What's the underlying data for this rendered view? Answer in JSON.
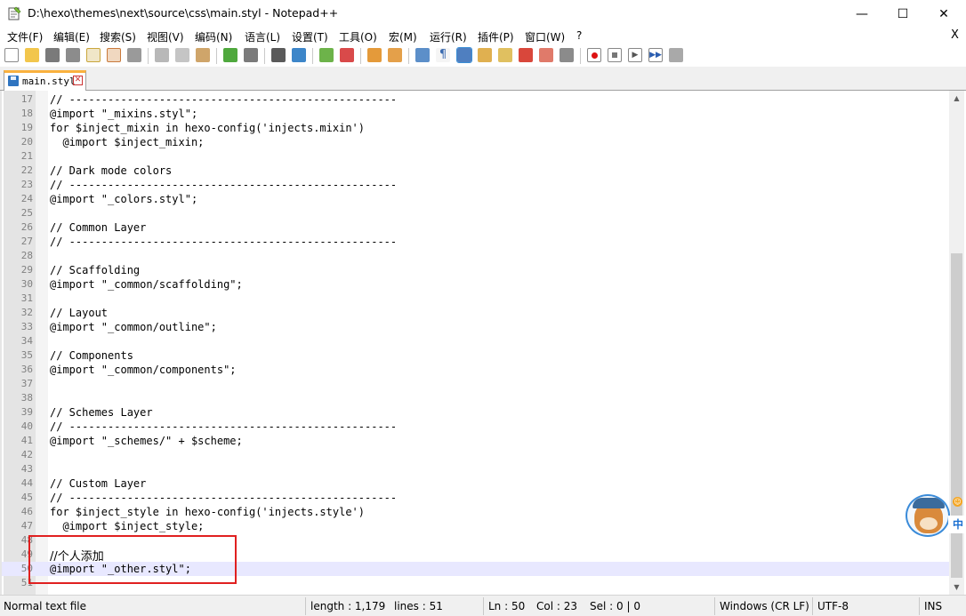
{
  "window": {
    "title": "D:\\hexo\\themes\\next\\source\\css\\main.styl - Notepad++",
    "min_glyph": "—",
    "max_glyph": "☐",
    "close_glyph": "✕"
  },
  "menu": {
    "items": [
      "文件(F)",
      "编辑(E)",
      "搜索(S)",
      "视图(V)",
      "编码(N)",
      "语言(L)",
      "设置(T)",
      "工具(O)",
      "宏(M)",
      "运行(R)",
      "插件(P)",
      "窗口(W)",
      "?"
    ],
    "close_glyph": "X"
  },
  "toolbar": {
    "icons": [
      "new-file-icon",
      "open-file-icon",
      "save-icon",
      "save-all-icon",
      "close-icon",
      "close-all-icon",
      "print-icon",
      "cut-icon",
      "copy-icon",
      "paste-icon",
      "undo-icon",
      "redo-icon",
      "find-icon",
      "replace-icon",
      "zoom-in-icon",
      "zoom-out-icon",
      "sync-vertical-icon",
      "sync-horizontal-icon",
      "word-wrap-icon",
      "show-all-characters-icon",
      "indent-guide-icon",
      "user-language-icon",
      "document-map-icon",
      "function-list-icon",
      "folder-as-workspace-icon",
      "monitoring-icon",
      "record-macro-icon",
      "stop-recording-icon",
      "playback-macro-icon",
      "run-macro-multiple-icon",
      "save-macro-icon"
    ]
  },
  "tab": {
    "label": "main.styl",
    "close_glyph": "✕"
  },
  "editor": {
    "current_line": 50,
    "lines": [
      {
        "n": "17",
        "text": "// ---------------------------------------------------"
      },
      {
        "n": "18",
        "text": "@import \"_mixins.styl\";"
      },
      {
        "n": "19",
        "text": "for $inject_mixin in hexo-config('injects.mixin')"
      },
      {
        "n": "20",
        "text": "  @import $inject_mixin;"
      },
      {
        "n": "21",
        "text": ""
      },
      {
        "n": "22",
        "text": "// Dark mode colors"
      },
      {
        "n": "23",
        "text": "// ---------------------------------------------------"
      },
      {
        "n": "24",
        "text": "@import \"_colors.styl\";"
      },
      {
        "n": "25",
        "text": ""
      },
      {
        "n": "26",
        "text": "// Common Layer"
      },
      {
        "n": "27",
        "text": "// ---------------------------------------------------"
      },
      {
        "n": "28",
        "text": ""
      },
      {
        "n": "29",
        "text": "// Scaffolding"
      },
      {
        "n": "30",
        "text": "@import \"_common/scaffolding\";"
      },
      {
        "n": "31",
        "text": ""
      },
      {
        "n": "32",
        "text": "// Layout"
      },
      {
        "n": "33",
        "text": "@import \"_common/outline\";"
      },
      {
        "n": "34",
        "text": ""
      },
      {
        "n": "35",
        "text": "// Components"
      },
      {
        "n": "36",
        "text": "@import \"_common/components\";"
      },
      {
        "n": "37",
        "text": ""
      },
      {
        "n": "38",
        "text": ""
      },
      {
        "n": "39",
        "text": "// Schemes Layer"
      },
      {
        "n": "40",
        "text": "// ---------------------------------------------------"
      },
      {
        "n": "41",
        "text": "@import \"_schemes/\" + $scheme;"
      },
      {
        "n": "42",
        "text": ""
      },
      {
        "n": "43",
        "text": ""
      },
      {
        "n": "44",
        "text": "// Custom Layer"
      },
      {
        "n": "45",
        "text": "// ---------------------------------------------------"
      },
      {
        "n": "46",
        "text": "for $inject_style in hexo-config('injects.style')"
      },
      {
        "n": "47",
        "text": "  @import $inject_style;"
      },
      {
        "n": "48",
        "text": ""
      },
      {
        "n": "49",
        "text": "//个人添加"
      },
      {
        "n": "50",
        "text": "@import \"_other.styl\";"
      },
      {
        "n": "51",
        "text": ""
      }
    ]
  },
  "assistant": {
    "badge": "中",
    "sun_glyph": "☺"
  },
  "statusbar": {
    "file_type": "Normal text file",
    "length": "length : 1,179",
    "lines": "lines : 51",
    "ln": "Ln : 50",
    "col": "Col : 23",
    "sel": "Sel : 0 | 0",
    "eol": "Windows (CR LF)",
    "encoding": "UTF-8",
    "mode": "INS"
  },
  "colors": {
    "current_line": "#e8e8ff",
    "gutter": "#e4e4e4",
    "tab_accent": "#fab13e",
    "highlight_box": "#e02020"
  }
}
